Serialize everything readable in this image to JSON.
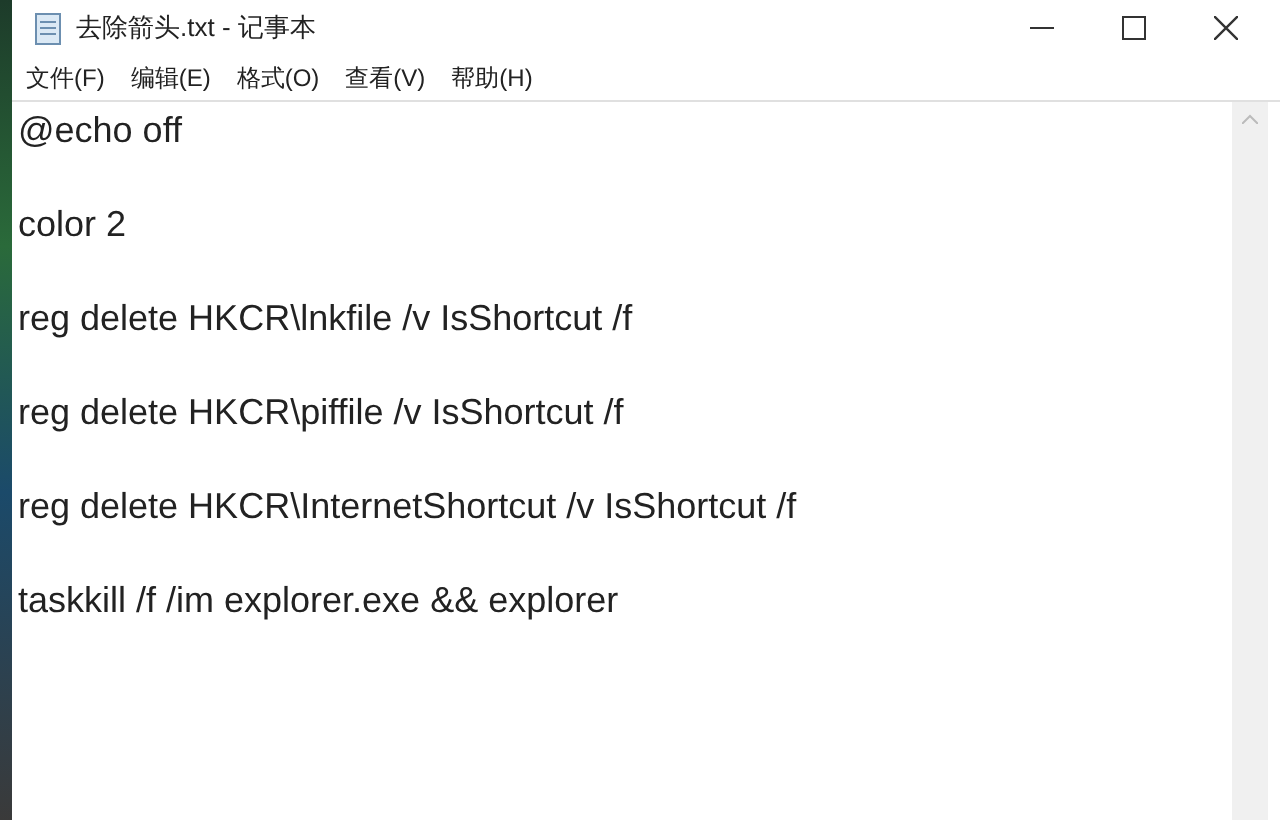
{
  "window": {
    "title": "去除箭头.txt - 记事本"
  },
  "menu": [
    "文件(F)",
    "编辑(E)",
    "格式(O)",
    "查看(V)",
    "帮助(H)"
  ],
  "document": {
    "lines": [
      "@echo off",
      "color 2",
      "reg delete HKCR\\lnkfile /v IsShortcut /f",
      "reg delete HKCR\\piffile /v IsShortcut /f",
      "reg delete HKCR\\InternetShortcut /v IsShortcut /f",
      "taskkill /f /im explorer.exe && explorer"
    ]
  }
}
